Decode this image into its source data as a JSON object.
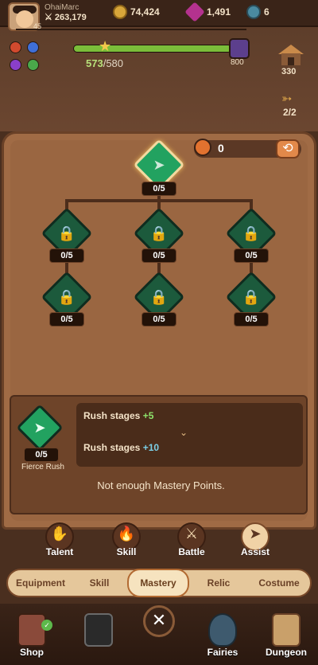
{
  "player": {
    "name": "OhaiMarc",
    "power": "263,179",
    "level": "45"
  },
  "resources": {
    "gold": "74,424",
    "gems": "1,491",
    "keys": "6"
  },
  "xp": {
    "current": "573",
    "max": "/580",
    "fraction": 0.988
  },
  "side": {
    "badge": "800",
    "house": "330",
    "stamina": "2/2"
  },
  "points": {
    "value": "0"
  },
  "tree": {
    "root": {
      "count": "0",
      "max": "/5"
    },
    "nodes": [
      {
        "count": "0",
        "max": "/5"
      },
      {
        "count": "0",
        "max": "/5"
      },
      {
        "count": "0",
        "max": "/5"
      },
      {
        "count": "0",
        "max": "/5"
      },
      {
        "count": "0",
        "max": "/5"
      },
      {
        "count": "0",
        "max": "/5"
      }
    ]
  },
  "info": {
    "count": "0",
    "max": "/5",
    "name": "Fierce Rush",
    "effect1_label": "Rush stages",
    "effect1_value": "+5",
    "effect2_label": "Rush stages",
    "effect2_value": "+10",
    "notice": "Not enough Mastery Points."
  },
  "categories": [
    {
      "label": "Talent"
    },
    {
      "label": "Skill"
    },
    {
      "label": "Battle"
    },
    {
      "label": "Assist"
    }
  ],
  "tabs": [
    {
      "label": "Equipment"
    },
    {
      "label": "Skill"
    },
    {
      "label": "Mastery"
    },
    {
      "label": "Relic"
    },
    {
      "label": "Costume"
    }
  ],
  "nav": [
    {
      "label": "Shop"
    },
    {
      "label": "Fairies"
    },
    {
      "label": "Dungeon"
    }
  ],
  "icons": {
    "close": "close-icon",
    "reset": "reset-icon",
    "lock": "lock-icon"
  }
}
